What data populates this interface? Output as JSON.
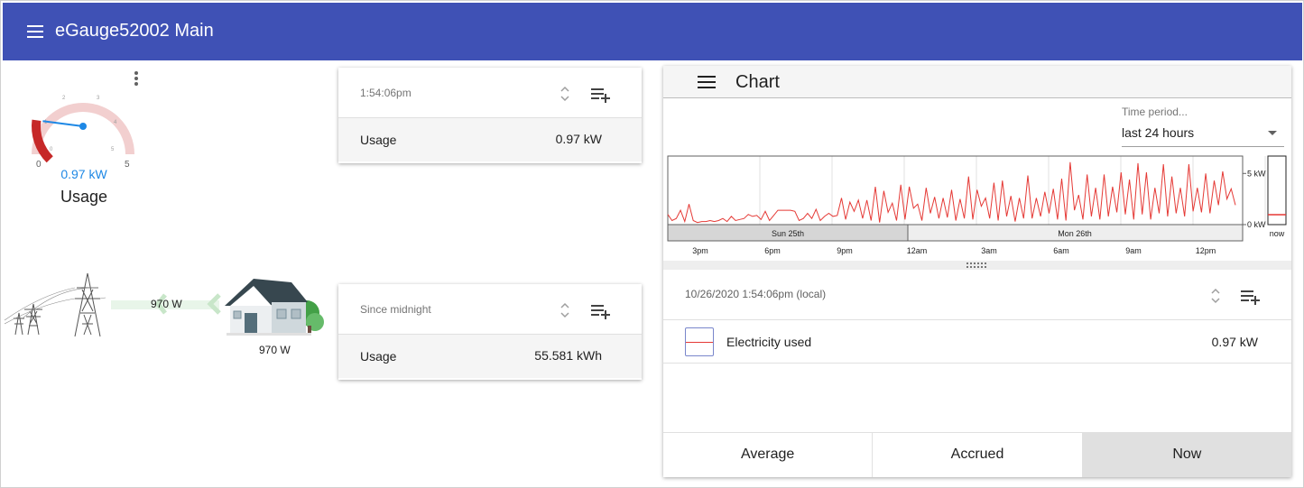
{
  "app": {
    "title": "eGauge52002 Main"
  },
  "gauge": {
    "value": "0.97 kW",
    "label": "Usage",
    "min_label": "0",
    "max_label": "5",
    "level": 0.194,
    "needle_color": "#1e88e5"
  },
  "flow": {
    "mid_watts": "970 W",
    "house_watts": "970 W"
  },
  "cards": [
    {
      "head": "1:54:06pm",
      "row_label": "Usage",
      "row_value": "0.97 kW"
    },
    {
      "head": "Since midnight",
      "row_label": "Usage",
      "row_value": "55.581 kWh"
    }
  ],
  "chart_panel": {
    "title": "Chart",
    "period": {
      "label": "Time period...",
      "value": "last 24 hours"
    },
    "detail_date": "10/26/2020 1:54:06pm (local)",
    "legend": {
      "label": "Electricity used",
      "value": "0.97 kW"
    },
    "tabs": [
      "Average",
      "Accrued",
      "Now"
    ]
  },
  "chart_data": {
    "type": "line",
    "series": [
      {
        "color": "#e53935",
        "values": [
          1.0,
          0.4,
          0.6,
          1.4,
          0.3,
          2.0,
          0.4,
          0.2,
          0.3,
          0.3,
          0.4,
          0.3,
          0.4,
          0.6,
          0.3,
          0.8,
          0.4,
          0.5,
          0.6,
          1.0,
          0.8,
          0.9,
          0.5,
          1.3,
          0.4,
          0.9,
          1.4,
          1.4,
          1.4,
          1.4,
          1.3,
          0.4,
          0.6,
          1.1,
          0.6,
          1.5,
          0.4,
          0.8,
          1.1,
          0.8,
          0.9,
          2.6,
          0.5,
          2.2,
          1.3,
          2.4,
          0.6,
          2.4,
          0.4,
          3.7,
          0.2,
          3.3,
          1.2,
          2.1,
          0.4,
          3.9,
          0.5,
          3.7,
          1.6,
          2.0,
          0.4,
          3.6,
          1.1,
          2.7,
          0.6,
          2.6,
          0.7,
          3.4,
          0.4,
          2.5,
          0.6,
          4.7,
          0.5,
          3.4,
          1.8,
          2.6,
          0.6,
          4.1,
          0.4,
          4.3,
          0.8,
          2.8,
          0.3,
          2.6,
          0.6,
          4.8,
          0.6,
          2.6,
          0.8,
          3.2,
          1.1,
          3.5,
          0.5,
          4.5,
          0.4,
          6.1,
          1.4,
          2.9,
          0.5,
          4.9,
          0.8,
          3.6,
          0.5,
          4.9,
          0.8,
          3.7,
          1.2,
          5.1,
          1.0,
          4.4,
          0.5,
          6.0,
          1.0,
          5.1,
          0.5,
          3.6,
          1.1,
          5.9,
          0.8,
          4.7,
          1.1,
          3.6,
          0.8,
          5.9,
          1.3,
          3.6,
          1.2,
          5.0,
          1.1,
          4.3,
          1.9,
          5.2,
          2.5,
          3.5,
          1.9
        ]
      }
    ],
    "y_ticks": [
      "0 kW",
      "5 kW"
    ],
    "ylim": [
      0,
      6.7
    ],
    "x_ticks": [
      "3pm",
      "6pm",
      "9pm",
      "12am",
      "3am",
      "6am",
      "9am",
      "12pm"
    ],
    "day_labels": [
      "Sun 25th",
      "Mon 26th"
    ],
    "now_label": "now",
    "now_value": 0.97
  }
}
